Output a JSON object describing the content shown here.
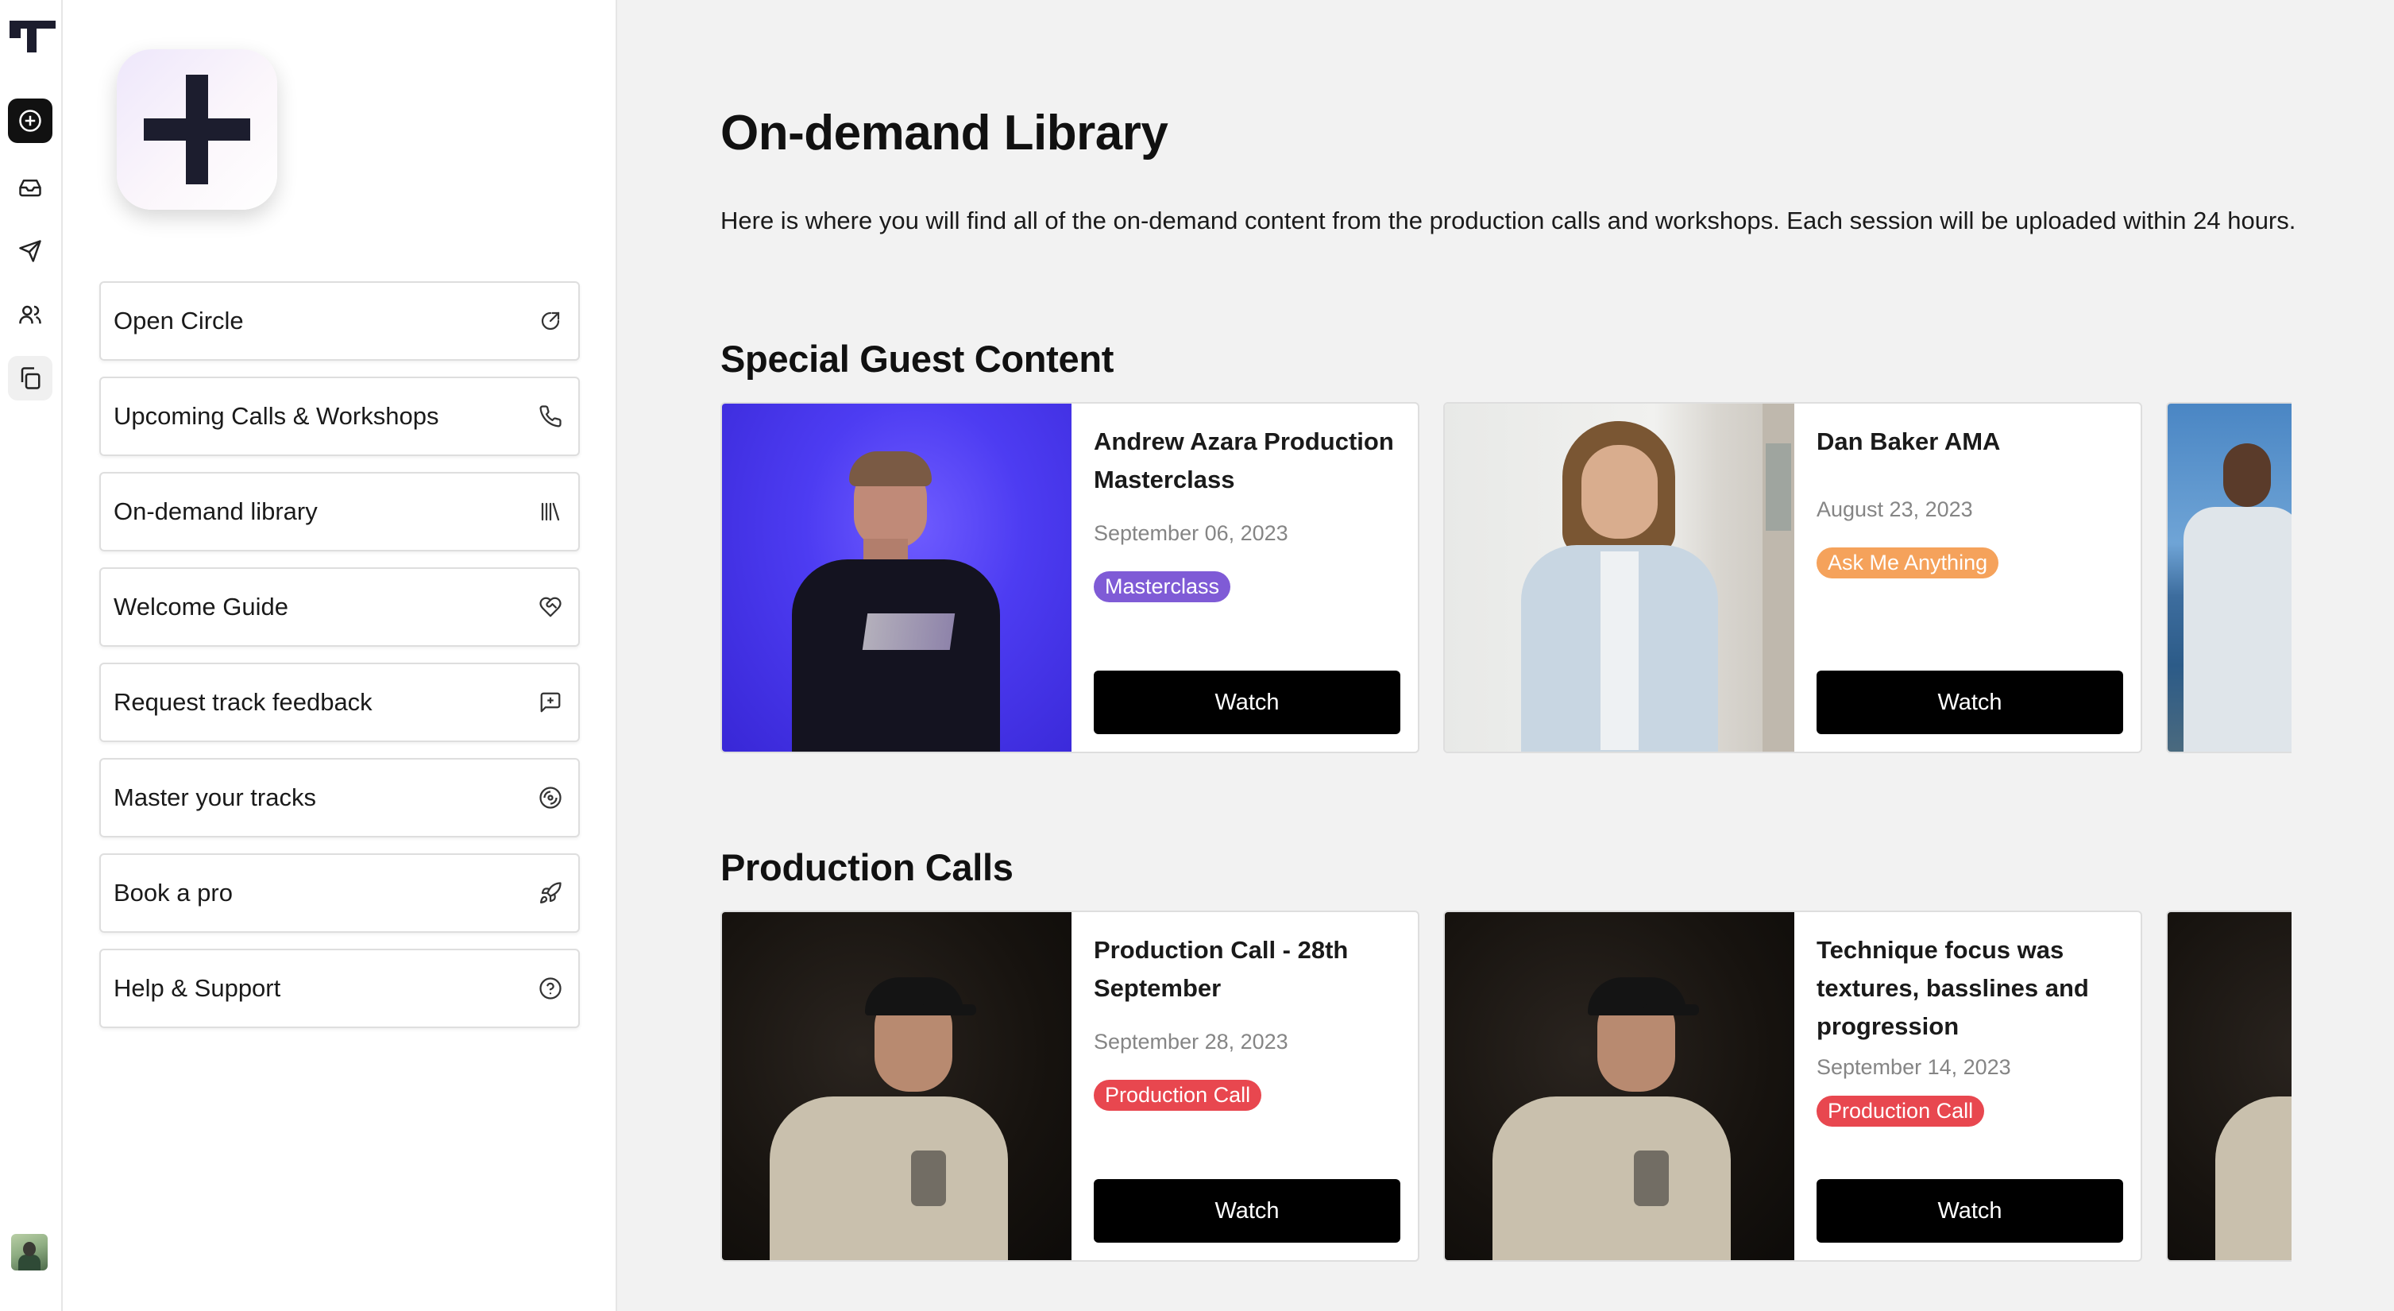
{
  "sidebar": {
    "nav": [
      {
        "label": "Open Circle",
        "icon": "external-link-icon"
      },
      {
        "label": "Upcoming Calls & Workshops",
        "icon": "phone-icon"
      },
      {
        "label": "On-demand library",
        "icon": "library-icon"
      },
      {
        "label": "Welcome Guide",
        "icon": "heart-handshake-icon"
      },
      {
        "label": "Request track feedback",
        "icon": "message-square-icon"
      },
      {
        "label": "Master your tracks",
        "icon": "disc-icon"
      },
      {
        "label": "Book a pro",
        "icon": "rocket-icon"
      },
      {
        "label": "Help & Support",
        "icon": "help-circle-icon"
      }
    ]
  },
  "main": {
    "title": "On-demand Library",
    "description": "Here is where you will find all of the on-demand content from the production calls and workshops. Each session will be uploaded within 24 hours.",
    "sections": [
      {
        "title": "Special Guest Content",
        "cards": [
          {
            "title": "Andrew Azara Production Masterclass",
            "date": "September 06, 2023",
            "tag": "Masterclass",
            "tag_color": "#7f5bd6",
            "button": "Watch"
          },
          {
            "title": "Dan Baker AMA",
            "date": "August 23, 2023",
            "tag": "Ask Me Anything",
            "tag_color": "#f5a25b",
            "button": "Watch"
          }
        ]
      },
      {
        "title": "Production Calls",
        "cards": [
          {
            "title": "Production Call - 28th September",
            "date": "September 28, 2023",
            "tag": "Production Call",
            "tag_color": "#e8474f",
            "button": "Watch"
          },
          {
            "title": "Technique focus was textures, basslines and progression",
            "date": "September 14, 2023",
            "tag": "Production Call",
            "tag_color": "#e8474f",
            "button": "Watch"
          }
        ]
      }
    ]
  }
}
